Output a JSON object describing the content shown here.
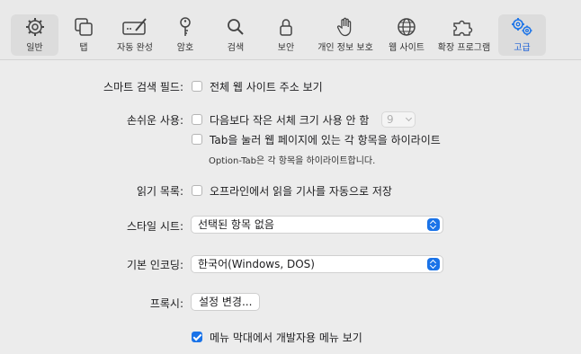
{
  "window": {
    "title": "고급"
  },
  "toolbar": {
    "items": [
      {
        "label": "일반",
        "icon": "gear-icon"
      },
      {
        "label": "탭",
        "icon": "tabs-icon"
      },
      {
        "label": "자동 완성",
        "icon": "autofill-pencil-icon"
      },
      {
        "label": "암호",
        "icon": "key-icon"
      },
      {
        "label": "검색",
        "icon": "search-icon"
      },
      {
        "label": "보안",
        "icon": "lock-icon"
      },
      {
        "label": "개인 정보 보호",
        "icon": "hand-icon"
      },
      {
        "label": "웹 사이트",
        "icon": "globe-icon"
      },
      {
        "label": "확장 프로그램",
        "icon": "puzzle-icon"
      },
      {
        "label": "고급",
        "icon": "gears-icon"
      }
    ],
    "accent": "#1a73e8"
  },
  "settings": {
    "smart_search": {
      "label": "스마트 검색 필드:",
      "option": "전체 웹 사이트 주소 보기",
      "checked": false
    },
    "accessibility": {
      "label": "손쉬운 사용:",
      "option1": "다음보다 작은 서체 크기 사용 안 함",
      "font_size_value": "9",
      "option2": "Tab을 눌러 웹 페이지에 있는 각 항목을 하이라이트",
      "note": "Option-Tab은 각 항목을 하이라이트합니다."
    },
    "reading_list": {
      "label": "읽기 목록:",
      "option": "오프라인에서 읽을 기사를 자동으로 저장"
    },
    "style_sheet": {
      "label": "스타일 시트:",
      "value": "선택된 항목 없음"
    },
    "encoding": {
      "label": "기본 인코딩:",
      "value": "한국어(Windows, DOS)"
    },
    "proxy": {
      "label": "프록시:",
      "button": "설정 변경..."
    },
    "develop_menu": {
      "option": "메뉴 막대에서 개발자용 메뉴 보기",
      "checked": true
    }
  }
}
